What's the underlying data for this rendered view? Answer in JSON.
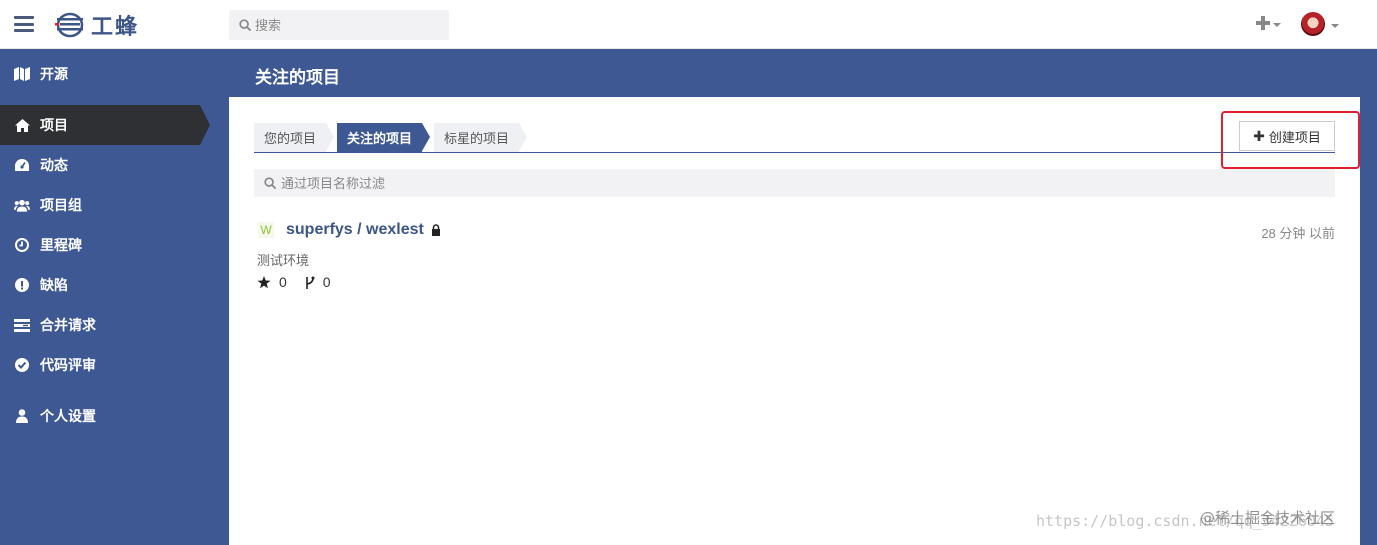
{
  "app": {
    "brand": "工蜂"
  },
  "search": {
    "placeholder": "搜索"
  },
  "sidebar": {
    "top": {
      "label": "开源",
      "icon": "map-icon"
    },
    "items": [
      {
        "label": "项目",
        "icon": "home-icon",
        "active": true
      },
      {
        "label": "动态",
        "icon": "dashboard-icon"
      },
      {
        "label": "项目组",
        "icon": "users-icon"
      },
      {
        "label": "里程碑",
        "icon": "clock-icon"
      },
      {
        "label": "缺陷",
        "icon": "exclamation-circle-icon"
      },
      {
        "label": "合并请求",
        "icon": "list-icon"
      },
      {
        "label": "代码评审",
        "icon": "check-circle-icon"
      },
      {
        "label": "个人设置",
        "icon": "user-icon"
      }
    ]
  },
  "header": {
    "title": "关注的项目"
  },
  "tabs": [
    {
      "label": "您的项目"
    },
    {
      "label": "关注的项目",
      "active": true
    },
    {
      "label": "标星的项目"
    }
  ],
  "toolbar": {
    "create_label": "创建项目"
  },
  "filter": {
    "placeholder": "通过项目名称过滤"
  },
  "projects": [
    {
      "avatar_letter": "W",
      "name": "superfys / wexlest",
      "time": "28 分钟 以前",
      "description": "测试环境",
      "stars": "0",
      "forks": "0"
    }
  ],
  "watermark": {
    "url": "https://blog.csdn.net/qq_34226045",
    "site": "@稀土掘金技术社区"
  },
  "colors": {
    "brand_blue": "#3d5893",
    "active_dark": "#2f3034",
    "highlight_red": "#e0202d"
  }
}
